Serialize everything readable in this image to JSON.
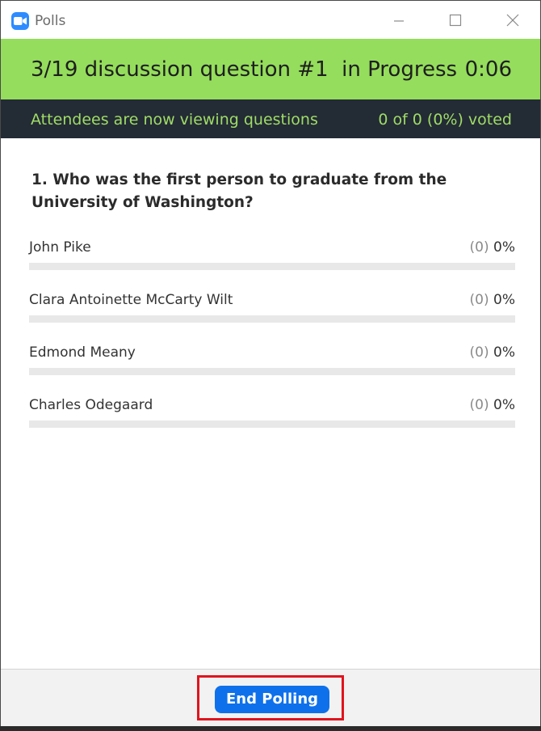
{
  "window": {
    "title": "Polls",
    "app_icon": "zoom-camera-icon",
    "controls": [
      "minimize-icon",
      "maximize-icon",
      "close-icon"
    ]
  },
  "status": {
    "title": "3/19 discussion question #1  in Progress",
    "timer": "0:06",
    "attendee_message": "Attendees are now viewing questions",
    "vote_summary": "0 of 0 (0%) voted"
  },
  "question": {
    "text": "1. Who was the first person to graduate from the University of Washington?"
  },
  "answers": [
    {
      "label": "John Pike",
      "count": "(0)",
      "percent": "0%",
      "fraction": 0
    },
    {
      "label": "Clara Antoinette McCarty Wilt",
      "count": "(0)",
      "percent": "0%",
      "fraction": 0
    },
    {
      "label": "Edmond Meany",
      "count": "(0)",
      "percent": "0%",
      "fraction": 0
    },
    {
      "label": "Charles Odegaard",
      "count": "(0)",
      "percent": "0%",
      "fraction": 0
    }
  ],
  "footer": {
    "end_button_label": "End Polling"
  },
  "colors": {
    "status_green": "#95dd5c",
    "info_bar": "#232b35",
    "info_text": "#9fdc66",
    "button_blue": "#0e71eb",
    "highlight_red": "#e0141e"
  }
}
